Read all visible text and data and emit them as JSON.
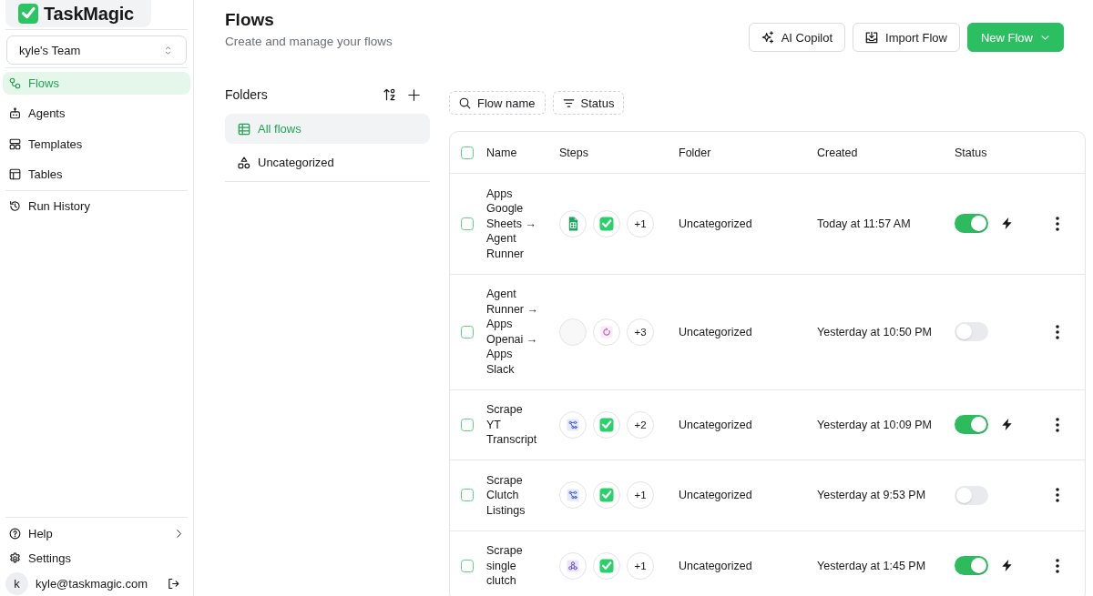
{
  "sidebar": {
    "logo": "TaskMagic",
    "team_select": {
      "value": "kyle's Team"
    },
    "nav": [
      {
        "label": "Flows",
        "selected": true
      },
      {
        "label": "Agents",
        "selected": false
      },
      {
        "label": "Templates",
        "selected": false
      },
      {
        "label": "Tables",
        "selected": false
      }
    ],
    "secondary_nav": [
      {
        "label": "Run History",
        "selected": false
      }
    ],
    "footer_items": [
      {
        "label": "Help",
        "submenu": true
      },
      {
        "label": "Settings",
        "submenu": false
      }
    ],
    "user": {
      "avatar": "k",
      "email": "kyle@taskmagic.com"
    }
  },
  "header": {
    "title": "Flows",
    "subtitle": "Create and manage your flows",
    "buttons": [
      {
        "label": "AI Copilot",
        "kind": "outline"
      },
      {
        "label": "Import Flow",
        "kind": "outline"
      },
      {
        "label": "New Flow",
        "kind": "primary"
      }
    ]
  },
  "folders": {
    "title": "Folders",
    "items": [
      {
        "label": "All flows",
        "selected": true
      },
      {
        "label": "Uncategorized",
        "selected": false
      }
    ]
  },
  "filters": [
    {
      "label": "Flow name"
    },
    {
      "label": "Status"
    }
  ],
  "table": {
    "select_all": {
      "checked": false
    },
    "columns": [
      "Name",
      "Steps",
      "Folder",
      "Created",
      "Status"
    ],
    "rows": [
      {
        "checked": false,
        "name": "Apps Google Sheets → Agent Runner",
        "steps": [
          {
            "kind": "sheet"
          },
          {
            "kind": "check"
          }
        ],
        "more": "+1",
        "folder": "Uncategorized",
        "created": "Today at 11:57 AM",
        "enabled": true
      },
      {
        "checked": false,
        "name": "Agent Runner → Apps Openai → Apps Slack",
        "steps": [
          {
            "kind": "blank"
          },
          {
            "kind": "refresh"
          }
        ],
        "more": "+3",
        "folder": "Uncategorized",
        "created": "Yesterday at 10:50 PM",
        "enabled": false
      },
      {
        "checked": false,
        "name": "Scrape YT Transcript",
        "steps": [
          {
            "kind": "nodes"
          },
          {
            "kind": "check"
          }
        ],
        "more": "+2",
        "folder": "Uncategorized",
        "created": "Yesterday at 10:09 PM",
        "enabled": true
      },
      {
        "checked": false,
        "name": "Scrape Clutch Listings",
        "steps": [
          {
            "kind": "nodes"
          },
          {
            "kind": "check"
          }
        ],
        "more": "+1",
        "folder": "Uncategorized",
        "created": "Yesterday at 9:53 PM",
        "enabled": false
      },
      {
        "checked": false,
        "name": "Scrape single clutch",
        "steps": [
          {
            "kind": "triad"
          },
          {
            "kind": "check"
          }
        ],
        "more": "+1",
        "folder": "Uncategorized",
        "created": "Yesterday at 1:45 PM",
        "enabled": true
      }
    ]
  }
}
